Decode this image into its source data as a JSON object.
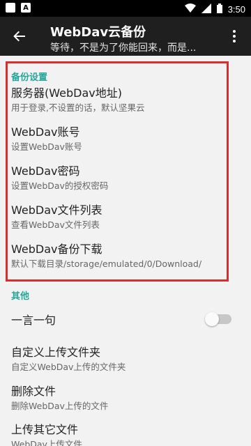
{
  "status_bar": {
    "time": "3:50",
    "left_icons": [
      "notification-icon",
      "a-app-icon"
    ],
    "right_icons": [
      "wifi-icon",
      "signal-icon",
      "battery-icon"
    ]
  },
  "toolbar": {
    "title": "WebDav云备份",
    "subtitle": "等待，不是为了你能回来，而是..."
  },
  "section_backup": {
    "title": "备份设置",
    "items": [
      {
        "title": "服务器(WebDav地址)",
        "subtitle": "用于登录,不设置的话，默认坚果云"
      },
      {
        "title": "WebDav账号",
        "subtitle": "设置WebDav账号"
      },
      {
        "title": "WebDav密码",
        "subtitle": "设置WebDav的授权密码"
      },
      {
        "title": "WebDav文件列表",
        "subtitle": "查看WebDav文件列表"
      },
      {
        "title": "WebDav备份下载",
        "subtitle": "默认下载目录/storage/emulated/0/Download/"
      }
    ]
  },
  "section_other": {
    "title": "其他",
    "items": [
      {
        "title": "一言一句",
        "subtitle": ""
      },
      {
        "title": "自定义上传文件夹",
        "subtitle": "自定义WebDav上传的文件夹"
      },
      {
        "title": "删除文件",
        "subtitle": "删除WebDav上传的文件"
      },
      {
        "title": "上传其它文件",
        "subtitle": "WebDav上传文件"
      }
    ],
    "toggle_on": false
  },
  "colors": {
    "accent": "#26a69a",
    "highlight_border": "#d82d2d",
    "toolbar_bg": "#1f1f1f"
  }
}
